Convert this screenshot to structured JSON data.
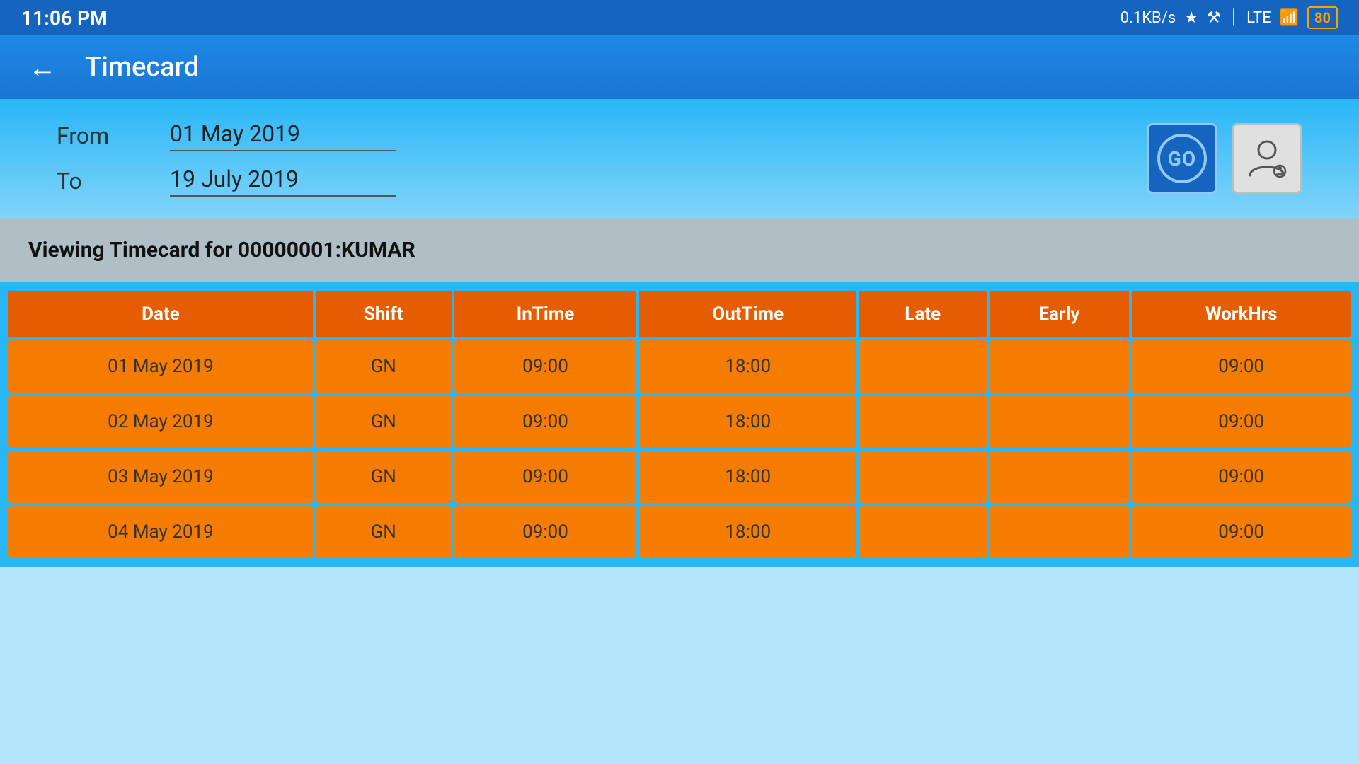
{
  "statusBar": {
    "time": "11:06 PM",
    "speed": "0.1KB/s",
    "battery": "80"
  },
  "appBar": {
    "title": "Timecard",
    "backArrow": "←"
  },
  "filter": {
    "fromLabel": "From",
    "fromValue": "01 May 2019",
    "toLabel": "To",
    "toValue": "19 July 2019",
    "goButtonLabel": "GO",
    "personButtonLabel": "Person"
  },
  "viewing": {
    "text": "Viewing Timecard for 00000001:KUMAR"
  },
  "table": {
    "columns": [
      "Date",
      "Shift",
      "InTime",
      "OutTime",
      "Late",
      "Early",
      "WorkHrs"
    ],
    "rows": [
      {
        "date": "01 May 2019",
        "shift": "GN",
        "intime": "09:00",
        "outtime": "18:00",
        "late": "",
        "early": "",
        "workhrs": "09:00"
      },
      {
        "date": "02 May 2019",
        "shift": "GN",
        "intime": "09:00",
        "outtime": "18:00",
        "late": "",
        "early": "",
        "workhrs": "09:00"
      },
      {
        "date": "03 May 2019",
        "shift": "GN",
        "intime": "09:00",
        "outtime": "18:00",
        "late": "",
        "early": "",
        "workhrs": "09:00"
      },
      {
        "date": "04 May 2019",
        "shift": "GN",
        "intime": "09:00",
        "outtime": "18:00",
        "late": "",
        "early": "",
        "workhrs": "09:00"
      }
    ]
  }
}
